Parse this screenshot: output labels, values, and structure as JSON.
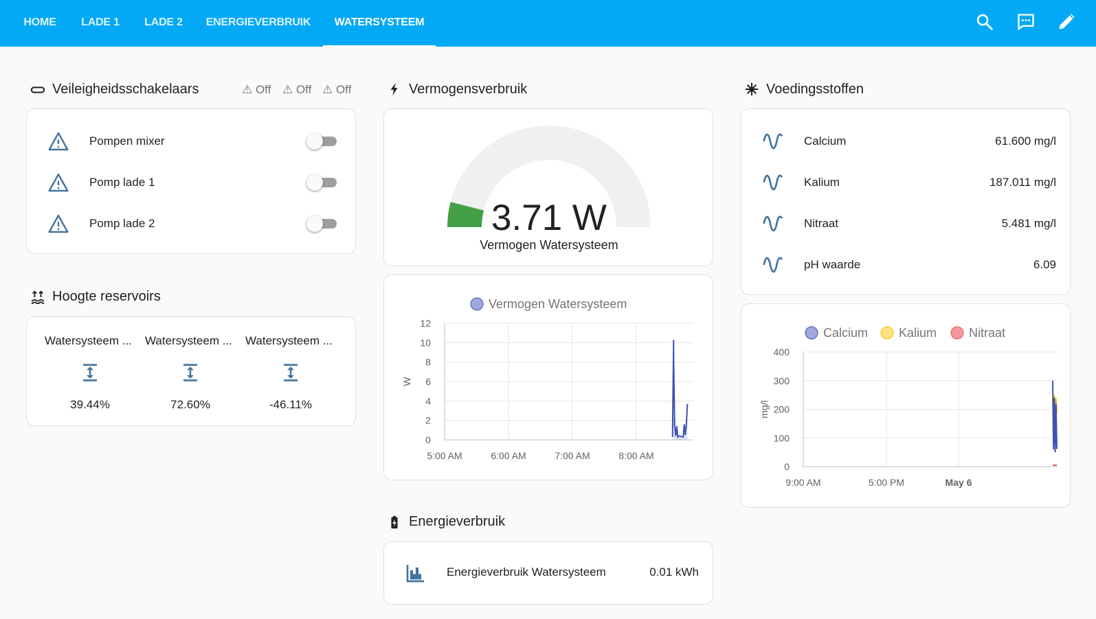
{
  "header": {
    "tabs": [
      {
        "label": "HOME",
        "active": false
      },
      {
        "label": "LADE 1",
        "active": false
      },
      {
        "label": "LADE 2",
        "active": false
      },
      {
        "label": "ENERGIEVERBRUIK",
        "active": false
      },
      {
        "label": "WATERSYSTEEM",
        "active": true
      }
    ],
    "icons": [
      "search-icon",
      "chat-icon",
      "pencil-icon"
    ],
    "color": "#03a9f4"
  },
  "safety": {
    "title": "Veileigheidsschakelaars",
    "badges": [
      "⚠ Off",
      "⚠ Off",
      "⚠ Off"
    ],
    "items": [
      {
        "label": "Pompen mixer",
        "state": "off"
      },
      {
        "label": "Pomp lade 1",
        "state": "off"
      },
      {
        "label": "Pomp lade 2",
        "state": "off"
      }
    ]
  },
  "reservoirs": {
    "title": "Hoogte reservoirs",
    "items": [
      {
        "label": "Watersysteem ...",
        "value": "39.44%"
      },
      {
        "label": "Watersysteem ...",
        "value": "72.60%"
      },
      {
        "label": "Watersysteem ...",
        "value": "-46.11%"
      }
    ]
  },
  "power": {
    "title": "Vermogensverbruik",
    "gauge": {
      "value": "3.71 W",
      "name": "Vermogen Watersysteem",
      "fraction": 0.08,
      "color": "#43a047"
    }
  },
  "energy": {
    "title": "Energieverbruik",
    "row": {
      "label": "Energieverbruik Watersysteem",
      "value": "0.01 kWh"
    }
  },
  "nutrients": {
    "title": "Voedingsstoffen",
    "items": [
      {
        "label": "Calcium",
        "value": "61.600 mg/l"
      },
      {
        "label": "Kalium",
        "value": "187.011 mg/l"
      },
      {
        "label": "Nitraat",
        "value": "5.481 mg/l"
      },
      {
        "label": "pH waarde",
        "value": "6.09"
      }
    ]
  },
  "chart_data": [
    {
      "type": "line",
      "series": [
        {
          "name": "Vermogen Watersysteem",
          "color": "#3f51b5",
          "points": [
            [
              "8:34",
              0.3
            ],
            [
              "8:35",
              10.3
            ],
            [
              "8:35",
              8.5
            ],
            [
              "8:36",
              1.5
            ],
            [
              "8:37",
              0.4
            ],
            [
              "8:38",
              1.4
            ],
            [
              "8:39",
              0.3
            ],
            [
              "8:40",
              0.4
            ],
            [
              "8:44",
              0.3
            ],
            [
              "8:45",
              1.6
            ],
            [
              "8:46",
              0.5
            ],
            [
              "8:47",
              1.5
            ],
            [
              "8:48",
              3.7
            ]
          ]
        }
      ],
      "x_ticks": [
        "5:00 AM",
        "6:00 AM",
        "7:00 AM",
        "8:00 AM"
      ],
      "y_ticks": [
        0,
        2,
        4,
        6,
        8,
        10,
        12
      ],
      "ylabel": "W",
      "ylim": [
        0,
        12
      ],
      "grid": true,
      "legend": "top"
    },
    {
      "type": "line",
      "series": [
        {
          "name": "Calcium",
          "color": "#3f51b5",
          "values": [
            300,
            60,
            240,
            50,
            220,
            62
          ]
        },
        {
          "name": "Kalium",
          "color": "#ffc107",
          "values": [
            250,
            80,
            250,
            190,
            240,
            187
          ]
        },
        {
          "name": "Nitraat",
          "color": "#ef5350",
          "values": [
            5,
            5,
            5,
            5,
            5,
            5
          ]
        }
      ],
      "x_ticks": [
        "9:00 AM",
        "5:00 PM",
        "May 6"
      ],
      "y_ticks": [
        0,
        100,
        200,
        300,
        400
      ],
      "ylabel": "mg/l",
      "ylim": [
        0,
        400
      ],
      "grid": true,
      "legend": "top"
    }
  ]
}
